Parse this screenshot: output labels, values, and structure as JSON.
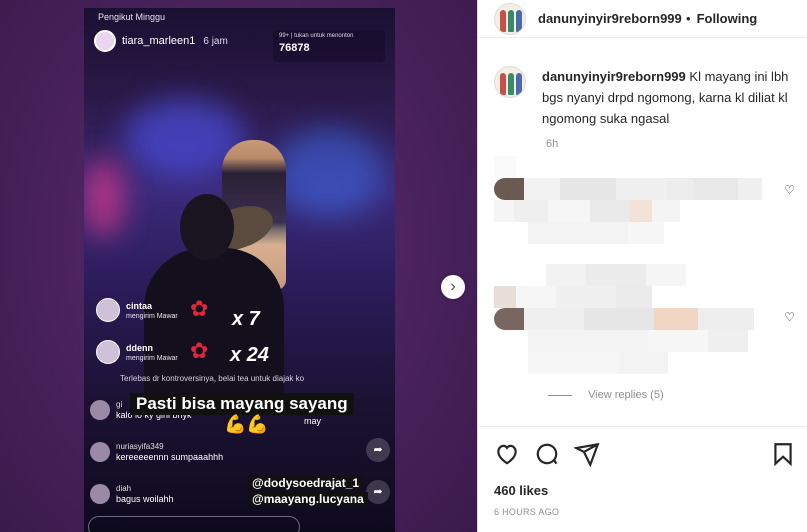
{
  "story": {
    "pinned_label": "Pengikut Minggu",
    "poster_name": "tiara_marleen1",
    "poster_time": "6 jam",
    "live_chip_text": "99+ | tukan untuk menonton",
    "viewer_count": "76878",
    "gifts": [
      {
        "user": "cintaa",
        "action": "mengirim Mawar",
        "count": "x 7"
      },
      {
        "user": "ddenn",
        "action": "mengirim Mawar",
        "count": "x 24"
      }
    ],
    "overlay_line": "Terlebas dr kontroversinya, belai tea untuk diajak ko",
    "caption": "Pasti bisa mayang sayang",
    "comments": [
      {
        "user": "gi",
        "msg": "kalo lo ky gini bnyk"
      },
      {
        "user": "nuriasyifa349",
        "msg": "kereeeeennn sumpaaahhh"
      },
      {
        "user": "diah",
        "msg": "bagus woilahh"
      }
    ],
    "may_text": "may",
    "mentions": [
      "@dodysoedrajat_1",
      "@maayang.lucyana"
    ]
  },
  "post": {
    "username": "danunyinyir9reborn999",
    "follow_label": "Following",
    "caption_user": "danunyinyir9reborn999",
    "caption_text": "Kl mayang ini lbh bgs nyanyi drpd ngomong, karna kl diliat kl ngomong suka ngasal",
    "caption_time": "6h",
    "view_replies": "View replies (5)",
    "likes": "460 likes",
    "time_ago": "6 HOURS AGO"
  },
  "icons": {
    "like": "heart-icon",
    "comment": "comment-icon",
    "share": "share-icon",
    "save": "bookmark-icon",
    "next": "chevron-right-icon"
  },
  "colors": {
    "background_purple": "#522a63",
    "text_primary": "#262626",
    "text_secondary": "#8e8e8e",
    "divider": "#efefef"
  }
}
